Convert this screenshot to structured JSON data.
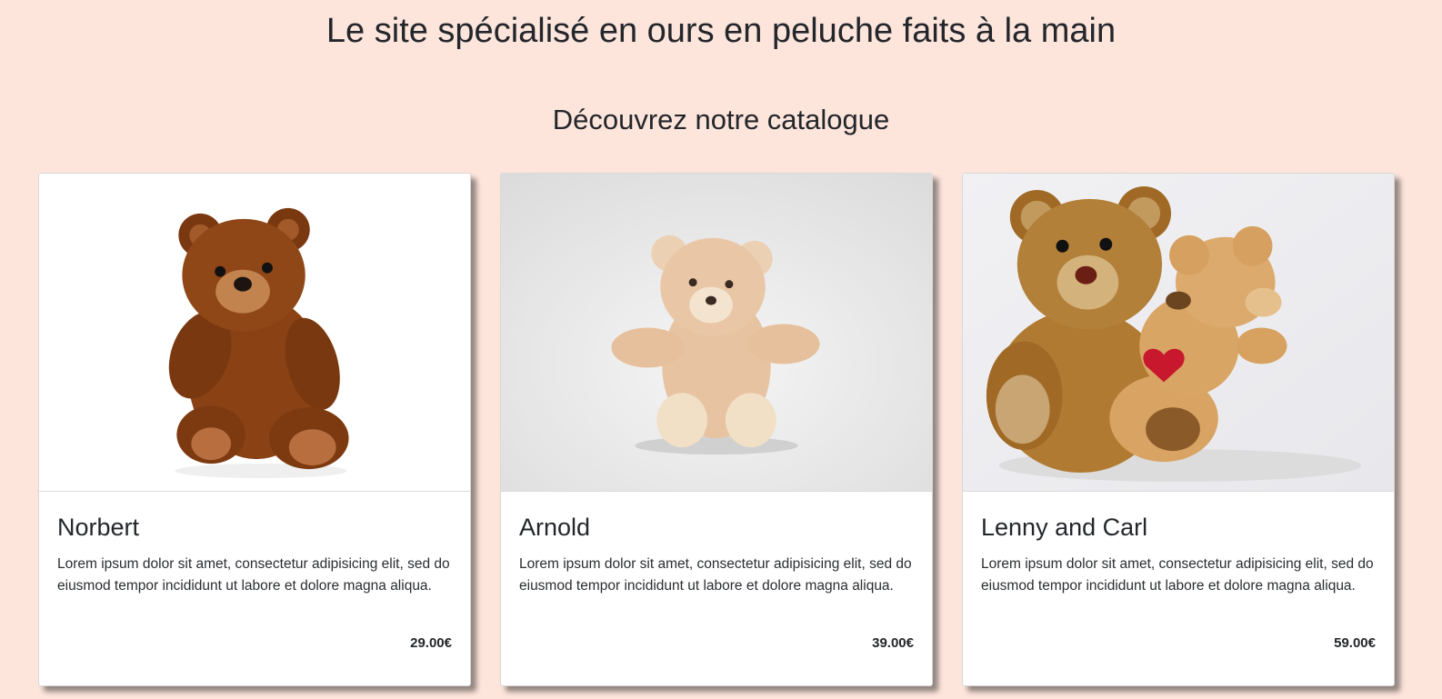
{
  "header": {
    "site_title": "Le site spécialisé en ours en peluche faits à la main",
    "catalog_heading": "Découvrez notre catalogue"
  },
  "products": [
    {
      "name": "Norbert",
      "description": "Lorem ipsum dolor sit amet, consectetur adipisicing elit, sed do eiusmod tempor incididunt ut labore et dolore magna aliqua.",
      "price": "29.00€",
      "image": "brown-teddy-bear-photo"
    },
    {
      "name": "Arnold",
      "description": "Lorem ipsum dolor sit amet, consectetur adipisicing elit, sed do eiusmod tempor incididunt ut labore et dolore magna aliqua.",
      "price": "39.00€",
      "image": "beige-teddy-bear-photo"
    },
    {
      "name": "Lenny and Carl",
      "description": "Lorem ipsum dolor sit amet, consectetur adipisicing elit, sed do eiusmod tempor incididunt ut labore et dolore magna aliqua.",
      "price": "59.00€",
      "image": "two-teddy-bears-hugging-photo"
    }
  ],
  "colors": {
    "page_background": "#fde5dc",
    "card_background": "#ffffff",
    "text": "#212529"
  }
}
